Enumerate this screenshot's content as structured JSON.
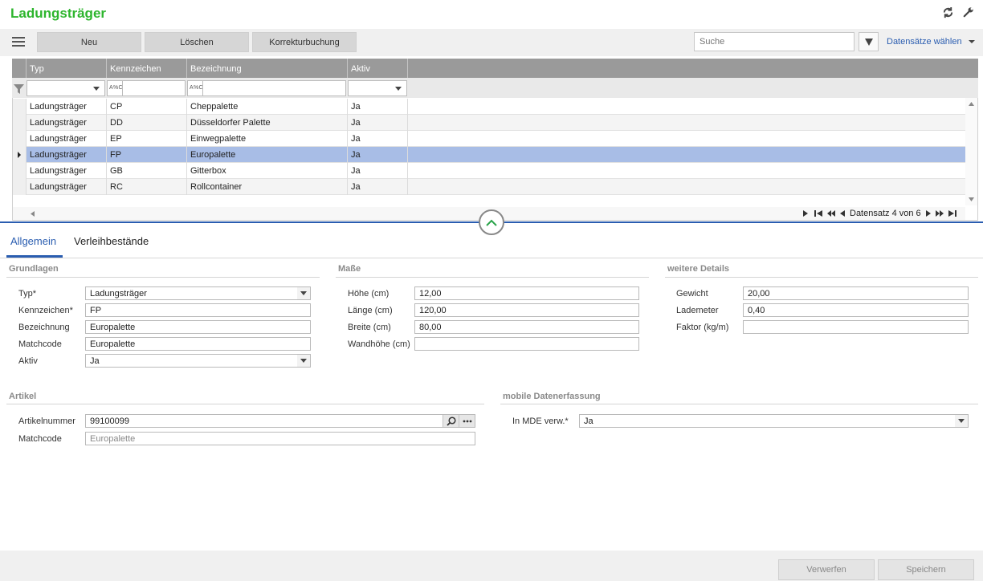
{
  "app": {
    "title": "Ladungsträger"
  },
  "toolbar": {
    "new_label": "Neu",
    "delete_label": "Löschen",
    "correction_label": "Korrekturbuchung",
    "search_placeholder": "Suche",
    "select_records_label": "Datensätze wählen"
  },
  "grid": {
    "columns": [
      "Typ",
      "Kennzeichen",
      "Bezeichnung",
      "Aktiv"
    ],
    "filter_text_hint": "A%C",
    "selected_row": 3,
    "rows": [
      {
        "typ": "Ladungsträger",
        "kennzeichen": "CP",
        "bezeichnung": "Cheppalette",
        "aktiv": "Ja"
      },
      {
        "typ": "Ladungsträger",
        "kennzeichen": "DD",
        "bezeichnung": "Düsseldorfer Palette",
        "aktiv": "Ja"
      },
      {
        "typ": "Ladungsträger",
        "kennzeichen": "EP",
        "bezeichnung": "Einwegpalette",
        "aktiv": "Ja"
      },
      {
        "typ": "Ladungsträger",
        "kennzeichen": "FP",
        "bezeichnung": "Europalette",
        "aktiv": "Ja"
      },
      {
        "typ": "Ladungsträger",
        "kennzeichen": "GB",
        "bezeichnung": "Gitterbox",
        "aktiv": "Ja"
      },
      {
        "typ": "Ladungsträger",
        "kennzeichen": "RC",
        "bezeichnung": "Rollcontainer",
        "aktiv": "Ja"
      }
    ],
    "pager_text": "Datensatz 4 von 6"
  },
  "tabs": [
    {
      "label": "Allgemein",
      "active": true
    },
    {
      "label": "Verleihbestände",
      "active": false
    }
  ],
  "grundlagen": {
    "title": "Grundlagen",
    "typ_label": "Typ*",
    "typ_value": "Ladungsträger",
    "kennzeichen_label": "Kennzeichen*",
    "kennzeichen_value": "FP",
    "bezeichnung_label": "Bezeichnung",
    "bezeichnung_value": "Europalette",
    "matchcode_label": "Matchcode",
    "matchcode_value": "Europalette",
    "aktiv_label": "Aktiv",
    "aktiv_value": "Ja"
  },
  "masse": {
    "title": "Maße",
    "hoehe_label": "Höhe (cm)",
    "hoehe_value": "12,00",
    "laenge_label": "Länge (cm)",
    "laenge_value": "120,00",
    "breite_label": "Breite (cm)",
    "breite_value": "80,00",
    "wandhoehe_label": "Wandhöhe (cm)",
    "wandhoehe_value": ""
  },
  "details": {
    "title": "weitere Details",
    "gewicht_label": "Gewicht",
    "gewicht_value": "20,00",
    "lademeter_label": "Lademeter",
    "lademeter_value": "0,40",
    "faktor_label": "Faktor (kg/m)",
    "faktor_value": ""
  },
  "artikel": {
    "title": "Artikel",
    "artikelnummer_label": "Artikelnummer",
    "artikelnummer_value": "99100099",
    "matchcode_label": "Matchcode",
    "matchcode_value": "Europalette"
  },
  "mde": {
    "title": "mobile Datenerfassung",
    "verw_label": "In MDE verw.*",
    "verw_value": "Ja"
  },
  "footer": {
    "discard_label": "Verwerfen",
    "save_label": "Speichern"
  }
}
